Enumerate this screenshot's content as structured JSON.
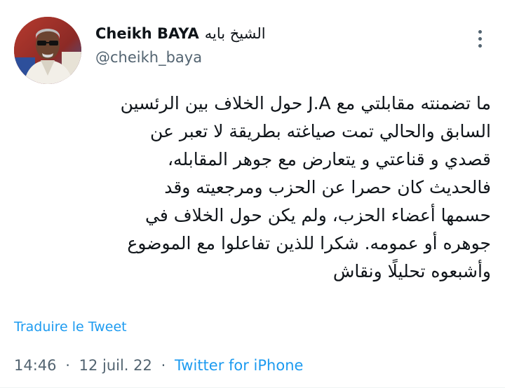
{
  "tweet": {
    "author": {
      "display_name_latin": "Cheikh BAYA",
      "display_name_arabic": "الشيخ بايه",
      "handle": "@cheikh_baya",
      "avatar_icon": "profile-photo"
    },
    "menu_icon": "more-options-icon",
    "lines": [
      "ما تضمنته مقابلتي مع J.A حول الخلاف بين الرئسين",
      "السابق والحالي تمت صياغته بطريقة لا تعبر عن",
      "قصدي و قناعتي و يتعارض مع جوهر المقابله،",
      "فالحديث كان حصرا عن الحزب ومرجعيته وقد",
      "حسمها أعضاء الحزب، ولم يكن حول الخلاف في",
      "جوهره أو عمومه. شكرا للذين تفاعلوا مع الموضوع",
      "وأشبعوه تحليلًا ونقاش"
    ],
    "translate_label": "Traduire le Tweet",
    "time": "14:46",
    "separator": "·",
    "date": "12 juil. 22",
    "source": "Twitter for iPhone"
  },
  "colors": {
    "link": "#1d9bf0",
    "secondary_text": "#536471",
    "primary_text": "#0f1419"
  }
}
